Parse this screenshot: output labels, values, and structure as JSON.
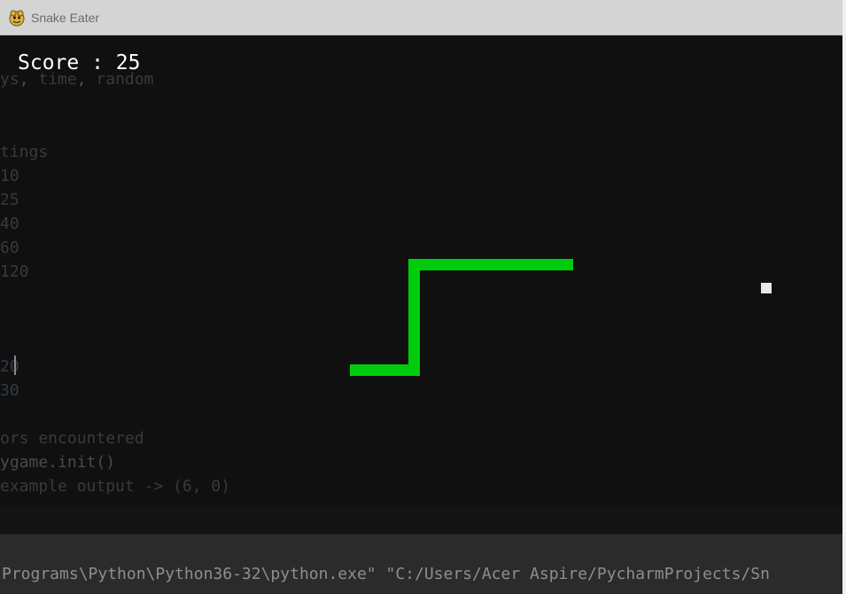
{
  "window": {
    "title": "Snake Eater",
    "icon": "pygame-snake-icon"
  },
  "game": {
    "score_text": "Score : 25",
    "score_value": 25,
    "snake_color": "#00cc0c",
    "food_color": "#e8e8e8",
    "background_color": "#101010"
  },
  "background_code": {
    "line1_a": "ys",
    "line1_sep1": ",",
    "line1_b": " time",
    "line1_sep2": ",",
    "line1_c": " random",
    "line2": "tings",
    "line3": "10",
    "line4": "25",
    "line5": "40",
    "line6": "60",
    "line7": "120",
    "line8": "20",
    "line9": "30",
    "line10": "ors encountered",
    "line11": "ygame.init()",
    "line12": "example output -> (6, 0)"
  },
  "terminal": {
    "command": "Programs\\Python\\Python36-32\\python.exe\" \"C:/Users/Acer Aspire/PycharmProjects/Sn"
  }
}
